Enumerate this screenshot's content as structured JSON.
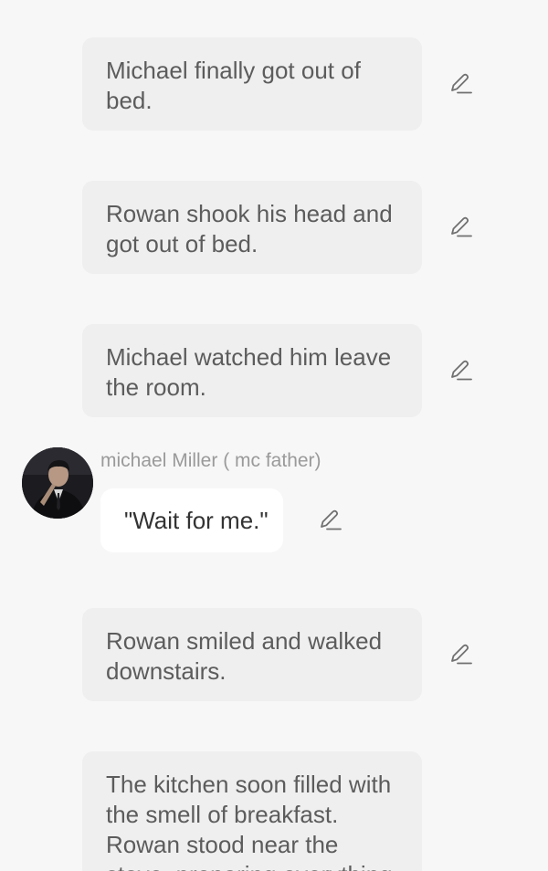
{
  "story": {
    "narration": [
      {
        "text": "Michael finally got out of bed."
      },
      {
        "text": "Rowan shook his head and got out of bed."
      },
      {
        "text": "Michael watched him leave the room."
      },
      {
        "text": "Rowan smiled and walked downstairs."
      },
      {
        "text": "The kitchen soon filled with the smell of breakfast. Rowan stood near the stove, preparing everything"
      }
    ],
    "dialogue": {
      "speaker": "michael Miller ( mc father)",
      "text": "\"Wait for me.\""
    }
  },
  "icons": {
    "edit": "pencil-edit-icon",
    "avatar": "character-avatar"
  },
  "colors": {
    "background": "#f7f7f7",
    "narration_bubble": "#efefef",
    "dialogue_bubble": "#ffffff",
    "narration_text": "#5c5c5c",
    "speaker_text": "#9a9a9a",
    "icon": "#707070"
  }
}
